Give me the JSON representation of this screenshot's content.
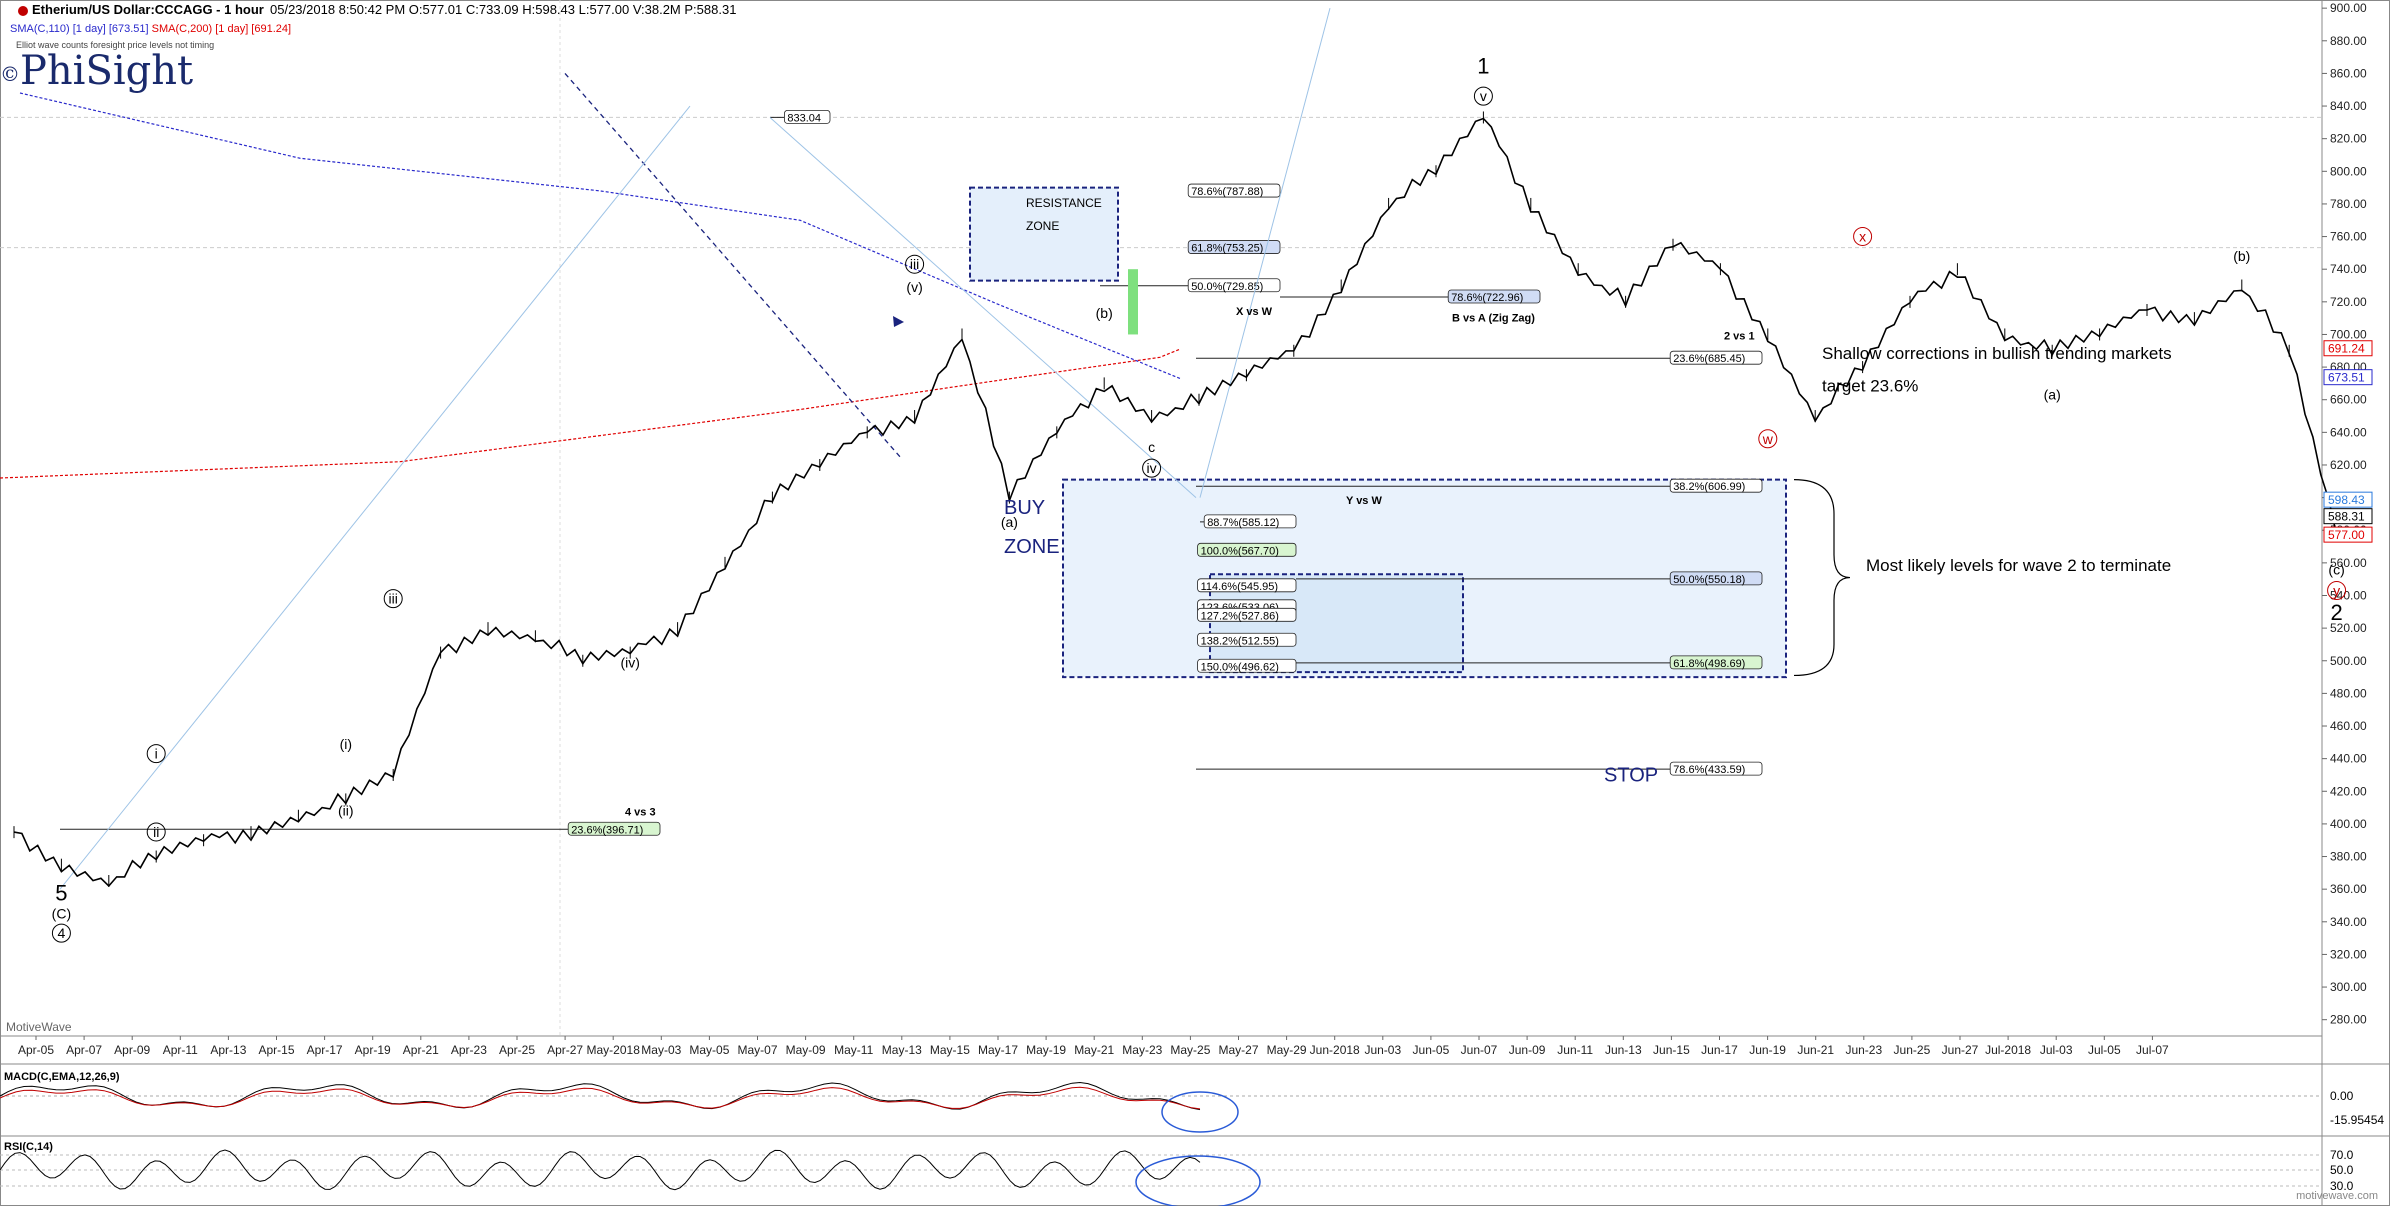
{
  "header": {
    "title": "Etherium/US Dollar:CCCAGG - 1 hour",
    "readout": "05/23/2018 8:50:42 PM  O:577.01  C:733.09  H:598.43  L:577.00  V:38.2M  P:588.31",
    "sma_110": "SMA(C,110) [1 day] [673.51]",
    "sma_200": "SMA(C,200) [1 day] [691.24]",
    "note": "Elliot wave counts foresight price levels not timing",
    "logo": "PhiSight",
    "logo_mark": "©",
    "watermark": "MotiveWave",
    "site": "motivewave.com"
  },
  "colors": {
    "price": "#000000",
    "sma110": "#2a2acc",
    "sma200": "#e00000",
    "zone_fill": "#e4effb",
    "zone_border": "#1a237e",
    "buy_text": "#1a237e",
    "green_label": "#d8f5d0",
    "blue_label": "#d0dcf5"
  },
  "chart_data": [
    {
      "type": "line",
      "series": [
        {
          "x": [
            "04/04",
            "04/05",
            "04/06",
            "04/07",
            "04/08",
            "04/09",
            "04/10",
            "04/11",
            "04/12",
            "04/13",
            "04/14",
            "04/15",
            "04/16",
            "04/17",
            "04/18",
            "04/19",
            "04/20",
            "04/21",
            "04/22",
            "04/23",
            "04/24",
            "04/25",
            "04/26",
            "04/27",
            "04/28",
            "04/29",
            "04/30",
            "05/01",
            "05/02",
            "05/03",
            "05/04",
            "05/05",
            "05/06",
            "05/07",
            "05/08",
            "05/09",
            "05/10",
            "05/11",
            "05/12",
            "05/13",
            "05/14",
            "05/15",
            "05/16",
            "05/17",
            "05/18",
            "05/19",
            "05/20",
            "05/21",
            "05/22",
            "05/23"
          ],
          "values": [
            395,
            375,
            365,
            380,
            390,
            395,
            405,
            415,
            430,
            505,
            520,
            515,
            500,
            505,
            520,
            560,
            600,
            620,
            640,
            650,
            700,
            600,
            640,
            670,
            650,
            660,
            675,
            690,
            730,
            780,
            800,
            833,
            780,
            740,
            720,
            755,
            740,
            700,
            650,
            680,
            720,
            740,
            700,
            690,
            700,
            715,
            710,
            730,
            690,
            577
          ]
        }
      ],
      "overlays": [
        {
          "name": "SMA(C,110) [1 day] [673.51]"
        },
        {
          "name": "SMA(C,200) [1 day] [691.24]"
        }
      ],
      "wave_labels": [
        {
          "text": "1",
          "x": "05/05",
          "y": 860
        },
        {
          "text": "v",
          "x": "05/05",
          "y": 843
        },
        {
          "text": "iii",
          "x": "04/23",
          "y": 740
        },
        {
          "text": "(v)",
          "x": "04/23",
          "y": 726
        },
        {
          "text": "(b)",
          "x": "04/27",
          "y": 710
        },
        {
          "text": "(a)",
          "x": "04/25",
          "y": 582
        },
        {
          "text": "c",
          "x": "04/28",
          "y": 628
        },
        {
          "text": "iv",
          "x": "04/28",
          "y": 615
        },
        {
          "text": "iii",
          "x": "04/12",
          "y": 535
        },
        {
          "text": "(iv)",
          "x": "04/17",
          "y": 496
        },
        {
          "text": "i",
          "x": "04/07",
          "y": 440
        },
        {
          "text": "(i)",
          "x": "04/11",
          "y": 446
        },
        {
          "text": "(ii)",
          "x": "04/11",
          "y": 405
        },
        {
          "text": "ii",
          "x": "04/07",
          "y": 392
        },
        {
          "text": "5",
          "x": "04/05",
          "y": 353
        },
        {
          "text": "(C)",
          "x": "04/05",
          "y": 342
        },
        {
          "text": "4",
          "x": "04/05",
          "y": 330
        },
        {
          "text": "w",
          "x": "05/11",
          "y": 633
        },
        {
          "text": "x",
          "x": "05/13",
          "y": 757
        },
        {
          "text": "(a)",
          "x": "05/17",
          "y": 660
        },
        {
          "text": "(b)",
          "x": "05/21",
          "y": 745
        },
        {
          "text": "(c)",
          "x": "05/23",
          "y": 553
        },
        {
          "text": "y",
          "x": "05/23",
          "y": 540
        },
        {
          "text": "2",
          "x": "05/23",
          "y": 525
        }
      ],
      "fib_levels": [
        {
          "label": "833.04",
          "value": 833.04
        },
        {
          "label": "78.6%(787.88)",
          "value": 787.88
        },
        {
          "label": "61.8%(753.25)",
          "value": 753.25
        },
        {
          "label": "50.0%(729.85)",
          "value": 729.85
        },
        {
          "label": "78.6%(722.96)",
          "value": 722.96
        },
        {
          "label": "23.6%(685.45)",
          "value": 685.45
        },
        {
          "label": "38.2%(606.99)",
          "value": 606.99
        },
        {
          "label": "88.7%(585.12)",
          "value": 585.12
        },
        {
          "label": "100.0%(567.70)",
          "value": 567.7
        },
        {
          "label": "114.6%(545.95)",
          "value": 545.95
        },
        {
          "label": "50.0%(550.18)",
          "value": 550.18
        },
        {
          "label": "123.6%(533.06)",
          "value": 533.06
        },
        {
          "label": "127.2%(527.86)",
          "value": 527.86
        },
        {
          "label": "138.2%(512.55)",
          "value": 512.55
        },
        {
          "label": "150.0%(496.62)",
          "value": 496.62
        },
        {
          "label": "61.8%(498.69)",
          "value": 498.69
        },
        {
          "label": "78.6%(433.59)",
          "value": 433.59
        },
        {
          "label": "23.6%(396.71)",
          "value": 396.71
        }
      ],
      "annotations": {
        "resistance_zone": "RESISTANCE ZONE",
        "buy_zone_1": "BUY",
        "buy_zone_2": "ZONE",
        "stop": "STOP",
        "x_vs_w": "X vs W",
        "b_vs_a": "B vs A (Zig Zag)",
        "two_vs_one": "2 vs 1",
        "y_vs_w": "Y vs W",
        "four_vs_three": "4 vs 3",
        "shallow_1": "Shallow corrections in bullish trending markets",
        "shallow_2": "target 23.6%",
        "most_likely": "Most likely levels for wave 2 to terminate"
      },
      "y_axis": {
        "ticks": [
          "900.00",
          "880.00",
          "860.00",
          "840.00",
          "820.00",
          "800.00",
          "780.00",
          "760.00",
          "740.00",
          "720.00",
          "700.00",
          "680.00",
          "660.00",
          "640.00",
          "620.00",
          "600.00",
          "580.00",
          "560.00",
          "540.00",
          "520.00",
          "500.00",
          "480.00",
          "460.00",
          "440.00",
          "420.00",
          "400.00",
          "380.00",
          "360.00",
          "340.00",
          "320.00",
          "300.00",
          "280.00"
        ],
        "ylim": [
          270,
          905
        ]
      },
      "price_tags": [
        {
          "label": "691.24",
          "value": 691.24
        },
        {
          "label": "673.51",
          "value": 673.51
        },
        {
          "label": "598.43",
          "value": 598.43
        },
        {
          "label": "588.31",
          "value": 588.31
        },
        {
          "label": "577.00",
          "value": 577.0
        }
      ],
      "x_axis": {
        "labels": [
          "Apr-05",
          "Apr-07",
          "Apr-09",
          "Apr-11",
          "Apr-13",
          "Apr-15",
          "Apr-17",
          "Apr-19",
          "Apr-21",
          "Apr-23",
          "Apr-25",
          "Apr-27",
          "May-2018",
          "May-03",
          "May-05",
          "May-07",
          "May-09",
          "May-11",
          "May-13",
          "May-15",
          "May-17",
          "May-19",
          "May-21",
          "May-23",
          "May-25",
          "May-27",
          "May-29",
          "Jun-2018",
          "Jun-03",
          "Jun-05",
          "Jun-07",
          "Jun-09",
          "Jun-11",
          "Jun-13",
          "Jun-15",
          "Jun-17",
          "Jun-19",
          "Jun-21",
          "Jun-23",
          "Jun-25",
          "Jun-27",
          "Jul-2018",
          "Jul-03",
          "Jul-05",
          "Jul-07"
        ]
      }
    },
    {
      "type": "line",
      "title": "MACD(C,EMA,12,26,9)",
      "ticks": [
        "0.00"
      ],
      "last_value": "-15.95454"
    },
    {
      "type": "line",
      "title": "RSI(C,14)",
      "ticks": [
        "70.0",
        "50.0",
        "30.0"
      ]
    }
  ]
}
